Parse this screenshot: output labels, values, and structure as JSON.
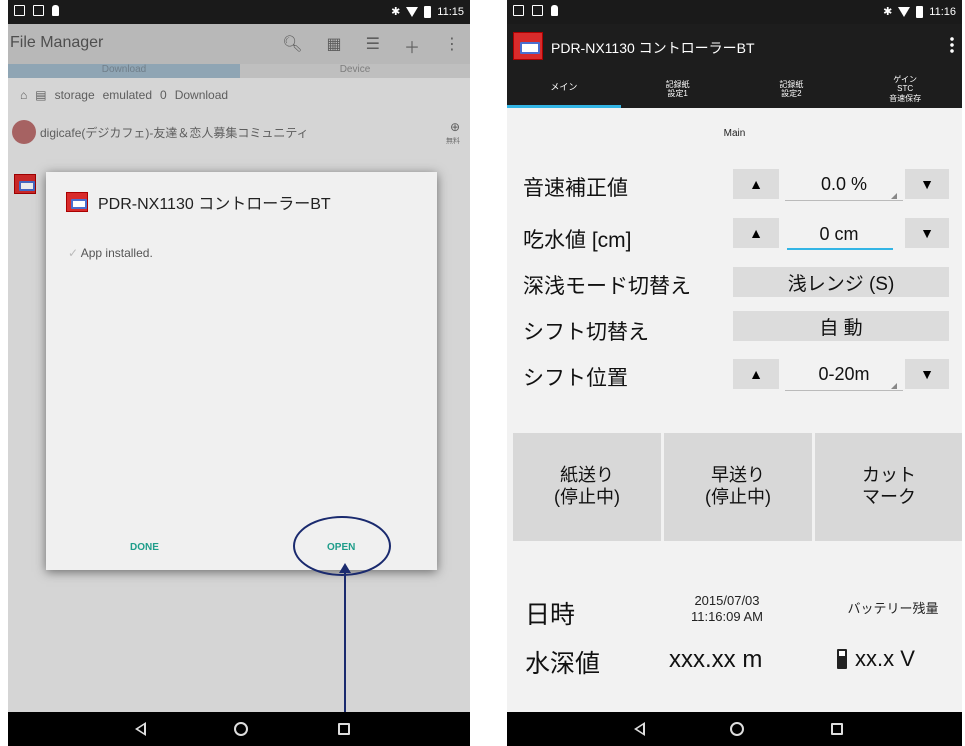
{
  "left": {
    "status_time": "11:15",
    "fm_title": "File Manager",
    "fm_icons": [
      "search-icon",
      "grid-icon",
      "sort-icon",
      "add-icon",
      "overflow-icon"
    ],
    "tabs": [
      "Download",
      "Device"
    ],
    "breadcrumb": [
      "storage",
      "emulated",
      "0",
      "Download"
    ],
    "list_item_1": "digicafe(デジカフェ)-友達＆恋人募集コミュニティ",
    "list_item_1_badge": "無料",
    "dialog": {
      "app_name": "PDR-NX1130 コントローラーBT",
      "message": "App installed.",
      "done": "DONE",
      "open": "OPEN"
    }
  },
  "right": {
    "status_time": "11:16",
    "app_title": "PDR-NX1130 コントローラーBT",
    "tabs": [
      "メイン",
      "記録紙\n設定1",
      "記録紙\n設定2",
      "ゲイン\nSTC\n音速保存"
    ],
    "section_label": "Main",
    "rows": {
      "sound_label": "音速補正値",
      "sound_value": "0.0 %",
      "draft_label": "吃水値 [cm]",
      "draft_value": "0 cm",
      "depth_mode_label": "深浅モード切替え",
      "depth_mode_value": "浅レンジ (S)",
      "shift_label": "シフト切替え",
      "shift_value": "自 動",
      "shift_pos_label": "シフト位置",
      "shift_pos_value": "0-20m"
    },
    "up": "▲",
    "down": "▼",
    "big_buttons": [
      "紙送り\n(停止中)",
      "早送り\n(停止中)",
      "カット\nマーク"
    ],
    "datetime_label": "日時",
    "date": "2015/07/03",
    "time": "11:16:09 AM",
    "battery_label": "バッテリー残量",
    "depth_label": "水深値",
    "depth_value": "xxx.xx m",
    "battery_value": "xx.x V"
  }
}
